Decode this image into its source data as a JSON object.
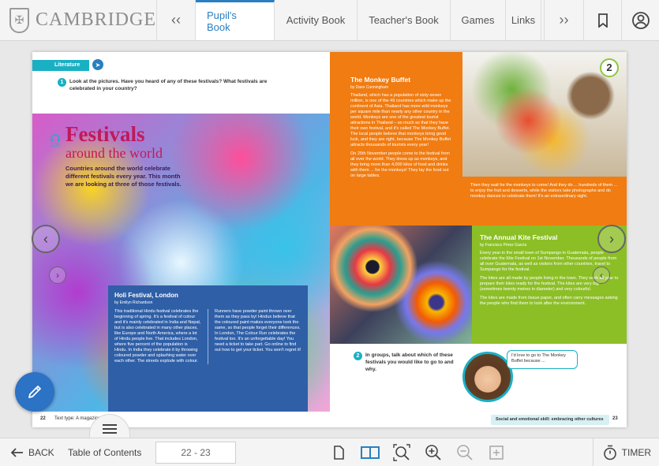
{
  "header": {
    "logo_word": "CAMBRIDGE",
    "prev_label": "‹‹",
    "next_label": "››",
    "tabs": [
      {
        "label": "Pupil's Book",
        "active": true
      },
      {
        "label": "Activity Book",
        "active": false
      },
      {
        "label": "Teacher's Book",
        "active": false
      },
      {
        "label": "Games",
        "active": false
      },
      {
        "label": "Links",
        "active": false
      }
    ],
    "accent_color": "#2a7fc1"
  },
  "left_page": {
    "section_tag": "Literature",
    "question_1_num": "1",
    "question_1": "Look at the pictures. Have you heard of any of these festivals? What festivals are celebrated in your country?",
    "audio_track": "1.20",
    "title_line1": "Festivals",
    "title_line2": "around the world",
    "subtitle": "Countries around the world celebrate different festivals every year. This month we are looking at three of those festivals.",
    "holi": {
      "title": "Holi Festival, London",
      "by": "by Emilyn Richardson",
      "col1": "This traditional Hindu festival celebrates the beginning of spring. It's a festival of colour and it's mainly celebrated in India and Nepal, but is also celebrated in many other places, like Europe and North America, where a lot of Hindu people live. That includes London, where five percent of the population is Hindu. In India they celebrate it by throwing coloured powder and splashing water over each other. The streets explode with colour.",
      "col2": "Runners have powder paint thrown over them as they pass by! Hindus believe that the coloured paint makes everyone look the same, so that people forget their differences. In London, The Colour Run celebrates the festival too. It's an unforgettable day! You need a ticket to take part. Go online to find out how to get your ticket. You won't regret it!"
    },
    "page_number": "22",
    "text_type": "Text type: A magazine"
  },
  "right_page": {
    "unit_number": "2",
    "monkey": {
      "title": "The Monkey Buffet",
      "by": "by Dave Cunningham",
      "p1": "Thailand, which has a population of sixty-seven million, is one of the 49 countries which make up the continent of Asia. Thailand has more wild monkeys per square mile than nearly any other country in the world. Monkeys are one of the greatest tourist attractions in Thailand – so much so that they have their own festival, and it's called The Monkey Buffet. The local people believe that monkeys bring good luck, and they are right, because The Monkey Buffet attracts thousands of tourists every year!",
      "p2": "On 25th November people come to the festival from all over the world. They dress up as monkeys, and they bring more than 4,000 kilos of food and drinks with them ... for the monkeys! They lay the food out on large tables.",
      "p3": "Then they wait for the monkeys to come! And they do ... hundreds of them ... to enjoy the fruit and desserts, while the visitors take photographs and do monkey dances to celebrate them! It's an extraordinary sight."
    },
    "kite": {
      "title": "The Annual Kite Festival",
      "by": "by Francisco Pérez García",
      "p1": "Every year in the small town of Sumpango in Guatemala, people celebrate the Kite Festival on 1st November. Thousands of people from all over Guatemala, as well as visitors from other countries, travel to Sumpango for the festival.",
      "p2": "The kites are all made by people living in the town. They work all year to prepare their kites ready for the festival. The kites are very big (sometimes twenty metres in diameter) and very colourful.",
      "p3": "The kites are made from tissue paper, and often carry messages asking the people who find them to look after the environment."
    },
    "question_2_num": "2",
    "question_2": "In groups, talk about which of these festivals you would like to go to and why.",
    "speech_bubble": "I'd love to go to The Monkey Buffet because ...",
    "tag": "Social and emotional skill: embracing other cultures",
    "page_number": "23"
  },
  "bottom": {
    "back_label": "BACK",
    "toc_label": "Table of Contents",
    "page_range": "22 - 23",
    "timer_label": "TIMER"
  },
  "icons": [
    "crest-icon",
    "bookmark-icon",
    "user-icon",
    "pointer-icon",
    "pen-icon",
    "menu-icon",
    "back-arrow-icon",
    "single-page-icon",
    "double-page-icon",
    "zoom-fit-icon",
    "zoom-in-icon",
    "zoom-out-icon",
    "fullscreen-icon",
    "timer-icon"
  ]
}
